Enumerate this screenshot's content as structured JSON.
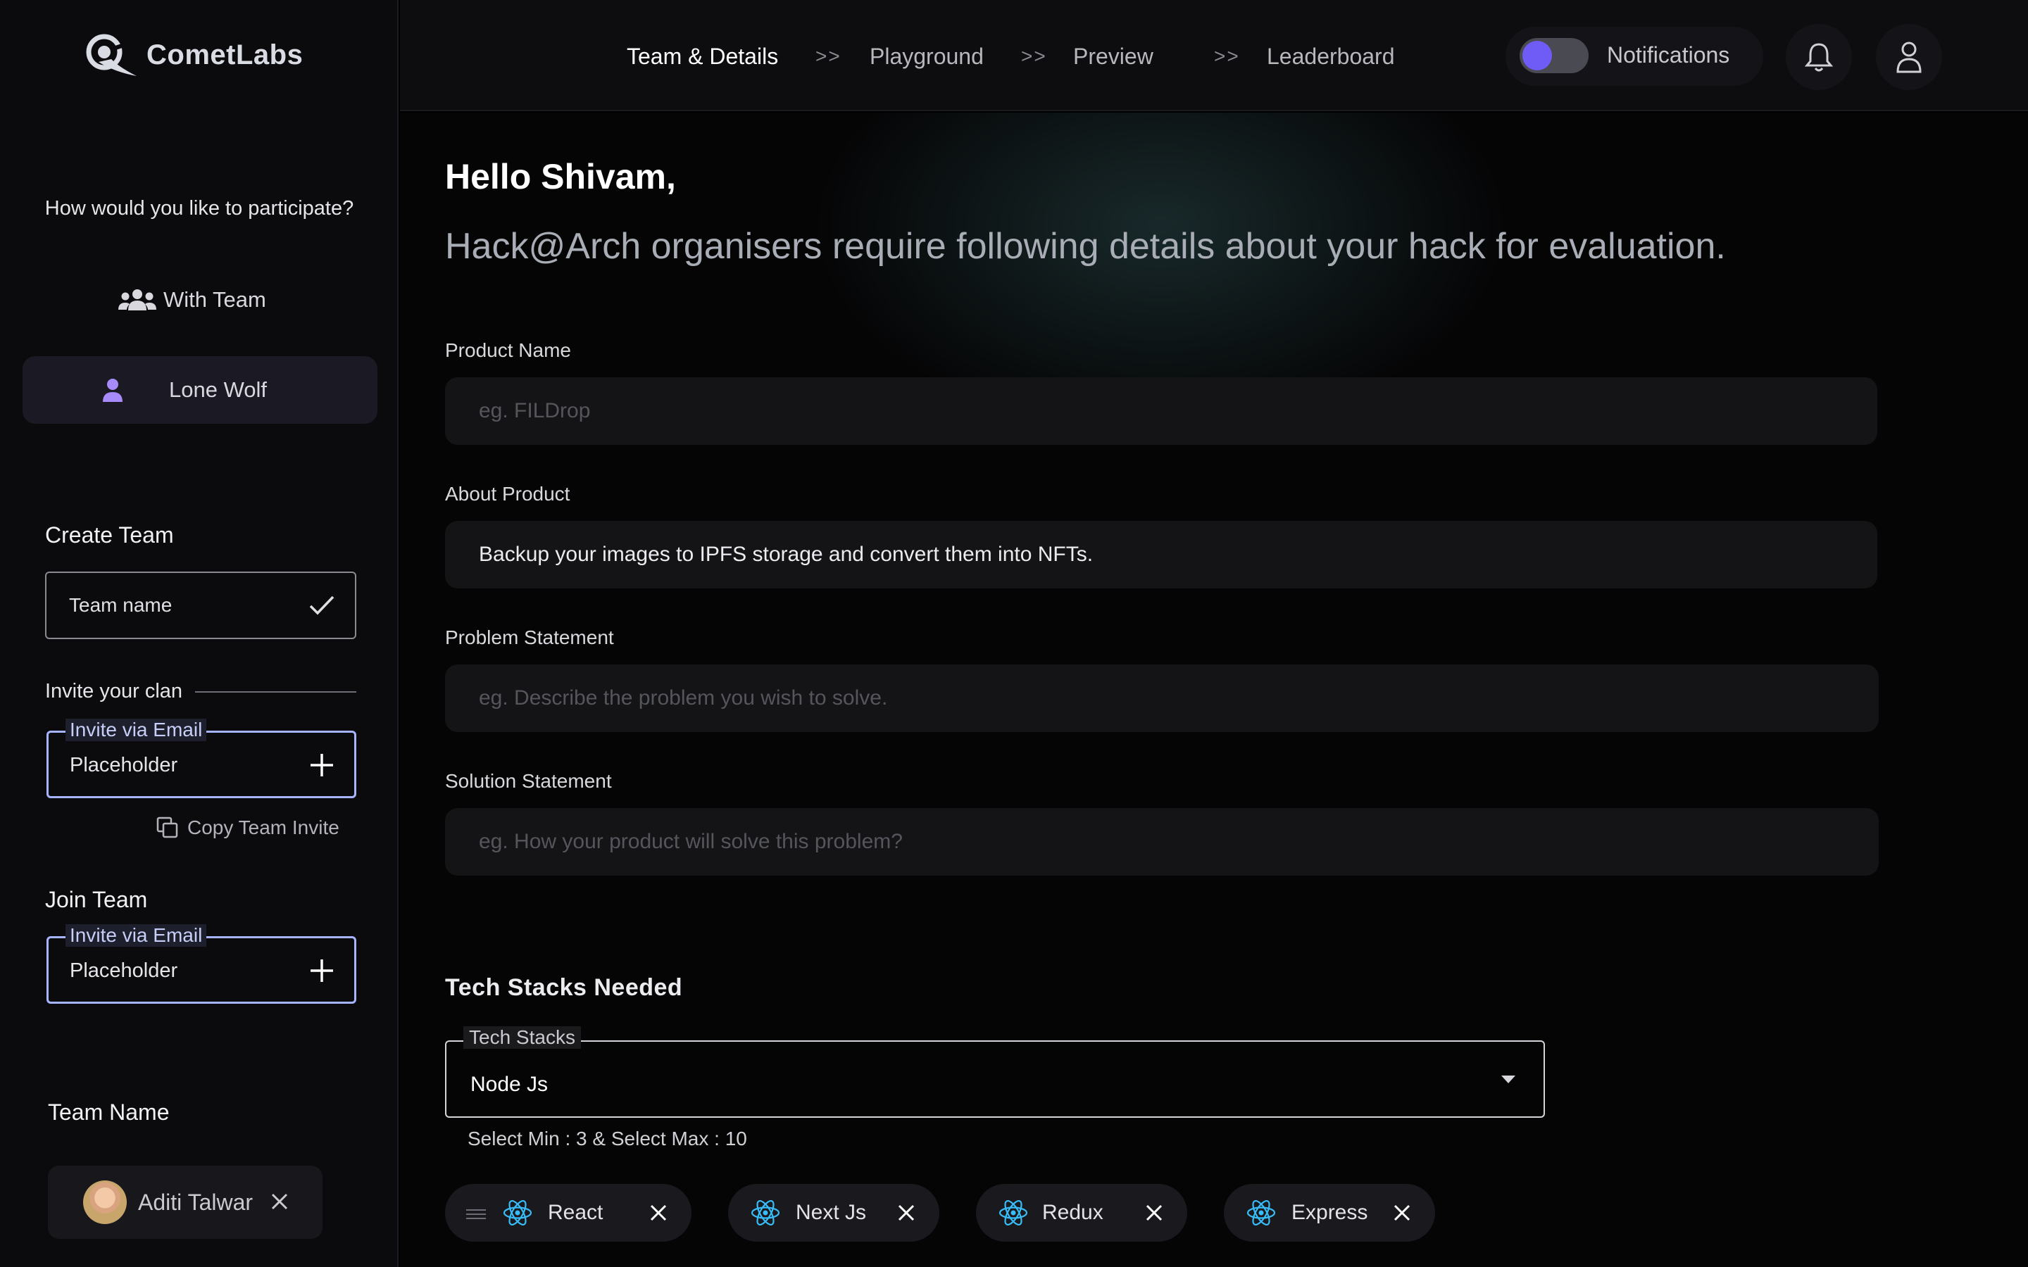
{
  "brand": {
    "name": "CometLabs"
  },
  "sidebar": {
    "question": "How would you like to participate?",
    "options": [
      {
        "label": "With Team",
        "icon": "group-icon",
        "selected": false
      },
      {
        "label": "Lone Wolf",
        "icon": "person-icon",
        "selected": true
      }
    ],
    "create_team": {
      "title": "Create Team",
      "team_name_placeholder": "Team name",
      "invite_clan_label": "Invite your clan",
      "invite_legend": "Invite via Email",
      "invite_placeholder": "Placeholder",
      "copy_invite": "Copy Team Invite"
    },
    "join_team": {
      "title": "Join Team",
      "invite_legend": "Invite via Email",
      "invite_placeholder": "Placeholder"
    },
    "team_name_section": {
      "title": "Team Name",
      "members": [
        {
          "name": "Aditi Talwar"
        }
      ]
    }
  },
  "header": {
    "breadcrumbs": [
      {
        "label": "Team & Details",
        "active": true
      },
      {
        "label": "Playground",
        "active": false
      },
      {
        "label": "Preview",
        "active": false
      },
      {
        "label": "Leaderboard",
        "active": false
      }
    ],
    "separator": ">>",
    "notifications": {
      "label": "Notifications",
      "enabled": true
    },
    "accent": "#6f5cf6"
  },
  "main": {
    "greeting": "Hello Shivam,",
    "subtitle": "Hack@Arch organisers require following details about your hack for evaluation.",
    "fields": {
      "product_name": {
        "label": "Product Name",
        "placeholder": "eg. FILDrop",
        "value": ""
      },
      "about_product": {
        "label": "About Product",
        "value": "Backup your images to IPFS storage and convert them into NFTs."
      },
      "problem_statement": {
        "label": "Problem Statement",
        "placeholder": "eg. Describe the problem you wish to solve.",
        "value": ""
      },
      "solution_statement": {
        "label": "Solution Statement",
        "placeholder": "eg. How your product will solve this problem?",
        "value": ""
      }
    },
    "tech_stacks": {
      "title": "Tech Stacks Needed",
      "legend": "Tech Stacks",
      "selected_value": "Node Js",
      "hint": "Select Min : 3 & Select Max : 10",
      "chips": [
        {
          "label": "React",
          "icon": "react-icon"
        },
        {
          "label": "Next Js",
          "icon": "react-icon"
        },
        {
          "label": "Redux",
          "icon": "react-icon"
        },
        {
          "label": "Express",
          "icon": "react-icon"
        }
      ]
    }
  }
}
